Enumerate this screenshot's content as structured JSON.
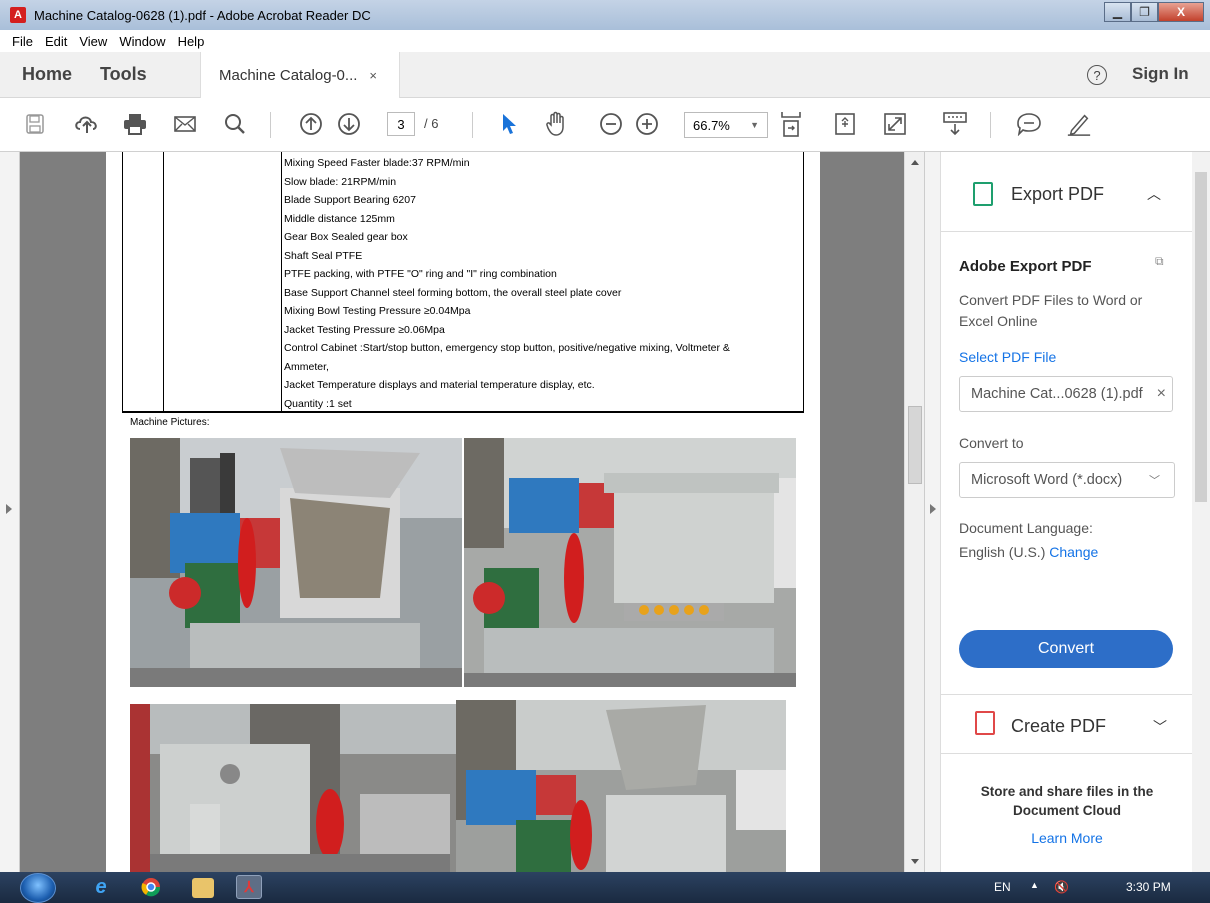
{
  "window": {
    "title": "Machine Catalog-0628 (1).pdf - Adobe Acrobat Reader DC",
    "app_icon": "acrobat-icon",
    "min_label": "▁",
    "max_label": "❐",
    "close_label": "X"
  },
  "menu": {
    "items": [
      "File",
      "Edit",
      "View",
      "Window",
      "Help"
    ]
  },
  "tabs": {
    "home": "Home",
    "tools": "Tools",
    "doc_tab": "Machine Catalog-0...",
    "doc_tab_close": "×",
    "help": "?",
    "sign_in": "Sign In"
  },
  "toolbar": {
    "page_current": "3",
    "page_total": "/ 6",
    "zoom": "66.7%",
    "icons": [
      "save-icon",
      "upload-icon",
      "print-icon",
      "email-icon",
      "search-icon",
      "prev-page-icon",
      "next-page-icon",
      "select-arrow-icon",
      "hand-icon",
      "zoom-out-icon",
      "zoom-in-icon",
      "fit-page-icon",
      "rotate-icon",
      "fullscreen-icon",
      "keyboard-icon",
      "comment-icon",
      "sign-icon"
    ]
  },
  "document": {
    "spec_lines": [
      "Mixing Speed  Faster blade:37 RPM/min",
      "Slow blade: 21RPM/min",
      "Blade Support Bearing   6207",
      "Middle distance      125mm",
      "Gear Box        Sealed gear box",
      "Shaft Seal       PTFE",
      "PTFE packing, with PTFE \"O\" ring and \"I\" ring combination",
      "Base Support  Channel steel forming bottom, the overall steel plate cover",
      "Mixing Bowl Testing Pressure        ≥0.04Mpa",
      "Jacket Testing Pressure   ≥0.06Mpa",
      "Control Cabinet :Start/stop button, emergency stop button, positive/negative mixing, Voltmeter &",
      "Ammeter,",
      "Jacket Temperature displays and material temperature display, etc.",
      "Quantity :1 set"
    ],
    "pictures_label": "Machine Pictures:"
  },
  "export_panel": {
    "header_label": "Export PDF",
    "title": "Adobe Export PDF",
    "description": "Convert PDF Files to Word or Excel Online",
    "select_link": "Select PDF File",
    "file_name": "Machine Cat...0628 (1).pdf",
    "file_clear": "×",
    "convert_to_label": "Convert to",
    "convert_to_value": "Microsoft Word (*.docx)",
    "language_label": "Document Language:",
    "language_value": "English (U.S.)",
    "change_link": "Change",
    "convert_button": "Convert",
    "create_pdf_label": "Create PDF",
    "cloud_text_1": "Store and share files in the",
    "cloud_text_2": "Document Cloud",
    "learn_more": "Learn More"
  },
  "taskbar": {
    "lang": "EN",
    "time": "3:30 PM"
  }
}
